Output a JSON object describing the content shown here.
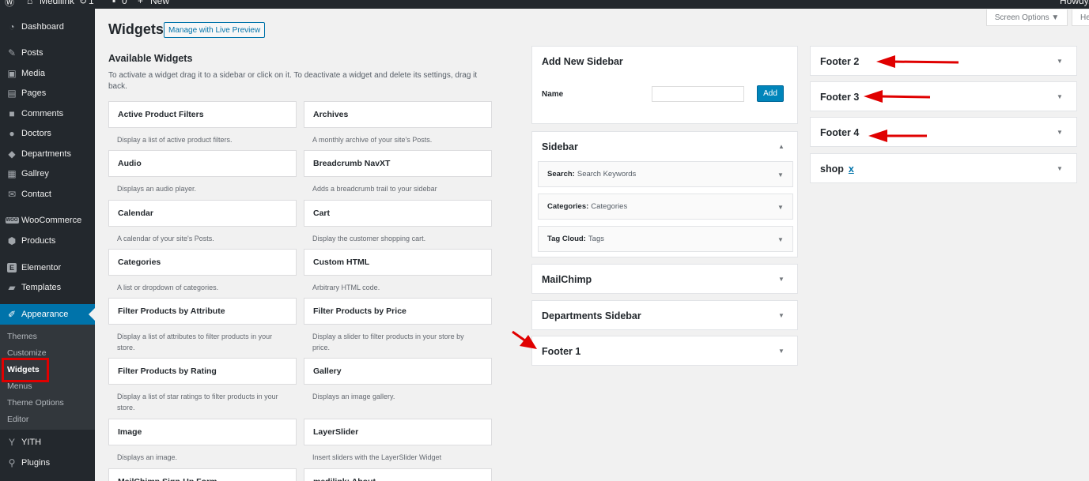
{
  "adminbar": {
    "site_name": "Medilink",
    "updates": "1",
    "comments": "0",
    "new_label": "New",
    "howdy": "Howdy,"
  },
  "menu": {
    "items": [
      {
        "label": "Dashboard",
        "icon": "dashboard-icon"
      },
      {
        "label": "Posts",
        "icon": "pin-icon"
      },
      {
        "label": "Media",
        "icon": "media-icon"
      },
      {
        "label": "Pages",
        "icon": "page-icon"
      },
      {
        "label": "Comments",
        "icon": "comment-icon"
      },
      {
        "label": "Doctors",
        "icon": "user-icon"
      },
      {
        "label": "Departments",
        "icon": "tag-icon"
      },
      {
        "label": "Gallrey",
        "icon": "gallery-icon"
      },
      {
        "label": "Contact",
        "icon": "mail-icon"
      },
      {
        "label": "WooCommerce",
        "icon": "woocommerce-icon",
        "badge": "WOO"
      },
      {
        "label": "Products",
        "icon": "products-icon"
      },
      {
        "label": "Elementor",
        "icon": "elementor-icon",
        "badge": "E"
      },
      {
        "label": "Templates",
        "icon": "folder-icon"
      },
      {
        "label": "Appearance",
        "icon": "brush-icon"
      },
      {
        "label": "YITH",
        "icon": "yith-icon"
      },
      {
        "label": "Plugins",
        "icon": "plugin-icon"
      }
    ],
    "submenu": [
      "Themes",
      "Customize",
      "Widgets",
      "Menus",
      "Theme Options",
      "Editor"
    ]
  },
  "header": {
    "title": "Widgets",
    "live_preview": "Manage with Live Preview",
    "screen_options": "Screen Options",
    "help": "He"
  },
  "available": {
    "heading": "Available Widgets",
    "description": "To activate a widget drag it to a sidebar or click on it. To deactivate a widget and delete its settings, drag it back.",
    "widgets": [
      {
        "title": "Active Product Filters",
        "desc": "Display a list of active product filters."
      },
      {
        "title": "Archives",
        "desc": "A monthly archive of your site's Posts."
      },
      {
        "title": "Audio",
        "desc": "Displays an audio player."
      },
      {
        "title": "Breadcrumb NavXT",
        "desc": "Adds a breadcrumb trail to your sidebar"
      },
      {
        "title": "Calendar",
        "desc": "A calendar of your site's Posts."
      },
      {
        "title": "Cart",
        "desc": "Display the customer shopping cart."
      },
      {
        "title": "Categories",
        "desc": "A list or dropdown of categories."
      },
      {
        "title": "Custom HTML",
        "desc": "Arbitrary HTML code."
      },
      {
        "title": "Filter Products by Attribute",
        "desc": "Display a list of attributes to filter products in your store."
      },
      {
        "title": "Filter Products by Price",
        "desc": "Display a slider to filter products in your store by price."
      },
      {
        "title": "Filter Products by Rating",
        "desc": "Display a list of star ratings to filter products in your store."
      },
      {
        "title": "Gallery",
        "desc": "Displays an image gallery."
      },
      {
        "title": "Image",
        "desc": "Displays an image."
      },
      {
        "title": "LayerSlider",
        "desc": "Insert sliders with the LayerSlider Widget"
      },
      {
        "title": "MailChimp Sign-Up Form",
        "desc": ""
      },
      {
        "title": "medilink: About",
        "desc": ""
      }
    ]
  },
  "add_sidebar": {
    "title": "Add New Sidebar",
    "name_label": "Name",
    "name_value": "",
    "add_button": "Add"
  },
  "sidebars": {
    "sidebar": {
      "title": "Sidebar",
      "widgets": [
        {
          "name": "Search:",
          "title": "Search Keywords"
        },
        {
          "name": "Categories:",
          "title": "Categories"
        },
        {
          "name": "Tag Cloud:",
          "title": "Tags"
        }
      ]
    },
    "mailchimp": "MailChimp",
    "departments": "Departments Sidebar",
    "footer1": "Footer 1",
    "footer2": "Footer 2",
    "footer3": "Footer 3",
    "footer4": "Footer 4",
    "shop": "shop",
    "shop_delete": "x"
  },
  "colors": {
    "accent": "#0073aa",
    "annotation": "#e00000",
    "menu_bg": "#23282d"
  }
}
